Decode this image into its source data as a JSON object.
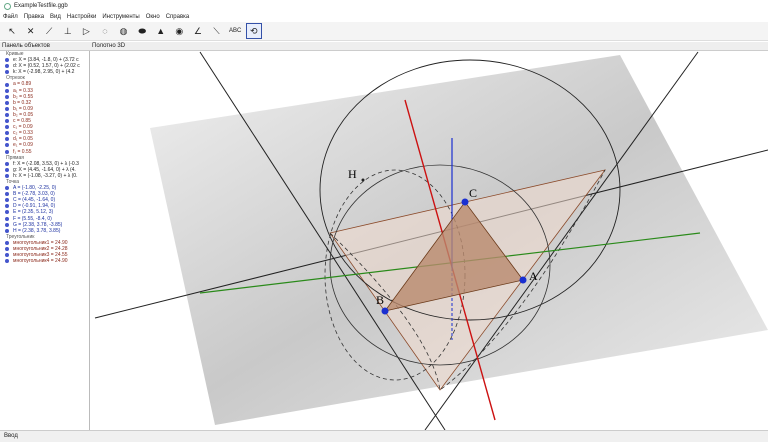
{
  "window": {
    "title": "ExampleTestfile.ggb"
  },
  "menu": [
    "Файл",
    "Правка",
    "Вид",
    "Настройки",
    "Инструменты",
    "Окно",
    "Справка"
  ],
  "toolbar": {
    "tools": [
      {
        "name": "move-tool",
        "glyph": "↖"
      },
      {
        "name": "point-tool",
        "glyph": "✕"
      },
      {
        "name": "line-tool",
        "glyph": "⟋"
      },
      {
        "name": "perpendicular-tool",
        "glyph": "⊥"
      },
      {
        "name": "polygon-tool",
        "glyph": "▷"
      },
      {
        "name": "circle-tool",
        "glyph": "◌"
      },
      {
        "name": "intersect-surfaces-tool",
        "glyph": "◍"
      },
      {
        "name": "conic-tool",
        "glyph": "⬬"
      },
      {
        "name": "pyramid-tool",
        "glyph": "▲"
      },
      {
        "name": "sphere-tool",
        "glyph": "◉"
      },
      {
        "name": "angle-tool",
        "glyph": "∠"
      },
      {
        "name": "reflect-tool",
        "glyph": "⟍"
      },
      {
        "name": "text-tool",
        "glyph": "ABC"
      },
      {
        "name": "rotate-view-tool",
        "glyph": "⟲"
      }
    ]
  },
  "panels": {
    "algebra_title": "Панель объектов",
    "view_title": "Полотно 3D"
  },
  "algebra": [
    {
      "group": "Кривые",
      "items": [
        {
          "t": "e: X = (3.84, -1.8, 0) + (3.72 c",
          "c": "blk"
        },
        {
          "t": "d: X = (0.52, 1.57, 0) + (2.02 c",
          "c": "blk"
        },
        {
          "t": "k: X = (-2.98, 2.95, 0) + (4.2",
          "c": "blk"
        }
      ]
    },
    {
      "group": "Отрезок",
      "items": [
        {
          "t": "a = 0.89",
          "c": "red"
        },
        {
          "t": "a₁ = 0.33",
          "c": "red"
        },
        {
          "t": "b₂ = 0.55",
          "c": "red"
        },
        {
          "t": "b = 0.32",
          "c": "red"
        },
        {
          "t": "b₁ = 0.09",
          "c": "red"
        },
        {
          "t": "b₂ = 0.05",
          "c": "red"
        },
        {
          "t": "c = 0.85",
          "c": "red"
        },
        {
          "t": "c₁ = 0.09",
          "c": "red"
        },
        {
          "t": "c₂ = 0.33",
          "c": "red"
        },
        {
          "t": "d₁ = 0.05",
          "c": "red"
        },
        {
          "t": "e₁ = 0.09",
          "c": "red"
        },
        {
          "t": "f₁ = 0.55",
          "c": "red"
        }
      ]
    },
    {
      "group": "Прямая",
      "items": [
        {
          "t": "f: X = (-2.08, 3.53, 0) + λ (-0.3",
          "c": "blk"
        },
        {
          "t": "g: X = (4.45, -1.64, 0) + λ (4.",
          "c": "blk"
        },
        {
          "t": "h: X = (-1.08, -3.27, 0) + λ (0.",
          "c": "blk"
        }
      ]
    },
    {
      "group": "Точка",
      "items": [
        {
          "t": "A = (-1.80, -2.25, 0)",
          "c": "blu"
        },
        {
          "t": "B = (-2.78, 3.03, 0)",
          "c": "blu"
        },
        {
          "t": "C = (4.45, -1.64, 0)",
          "c": "blu"
        },
        {
          "t": "D = (-0.91, 1.94, 0)",
          "c": "blu"
        },
        {
          "t": "E = (2.35, 5.12, 3)",
          "c": "blu"
        },
        {
          "t": "F = (5.55, -8.4, 0)",
          "c": "blu"
        },
        {
          "t": "G = (2.38, 3.78, -3.85)",
          "c": "blu"
        },
        {
          "t": "H = (2.38, 3.78, 3.85)",
          "c": "blu"
        }
      ]
    },
    {
      "group": "Треугольник",
      "items": [
        {
          "t": "многоугольник1 = 24.90",
          "c": "red"
        },
        {
          "t": "многоугольник2 = 24.28",
          "c": "red"
        },
        {
          "t": "многоугольник3 = 24.55",
          "c": "red"
        },
        {
          "t": "многоугольник4 = 24.90",
          "c": "red"
        }
      ]
    }
  ],
  "view3d": {
    "points": {
      "A": "A",
      "B": "B",
      "C": "C",
      "H": "H"
    }
  },
  "status": {
    "input_label": "Ввод"
  },
  "colors": {
    "accent": "#3451a8",
    "triangle": "#b98a6e",
    "point": "#1a2fd0",
    "x_axis": "#cc1111",
    "y_axis": "#2a8a1a",
    "z_axis": "#1a2fd0"
  }
}
